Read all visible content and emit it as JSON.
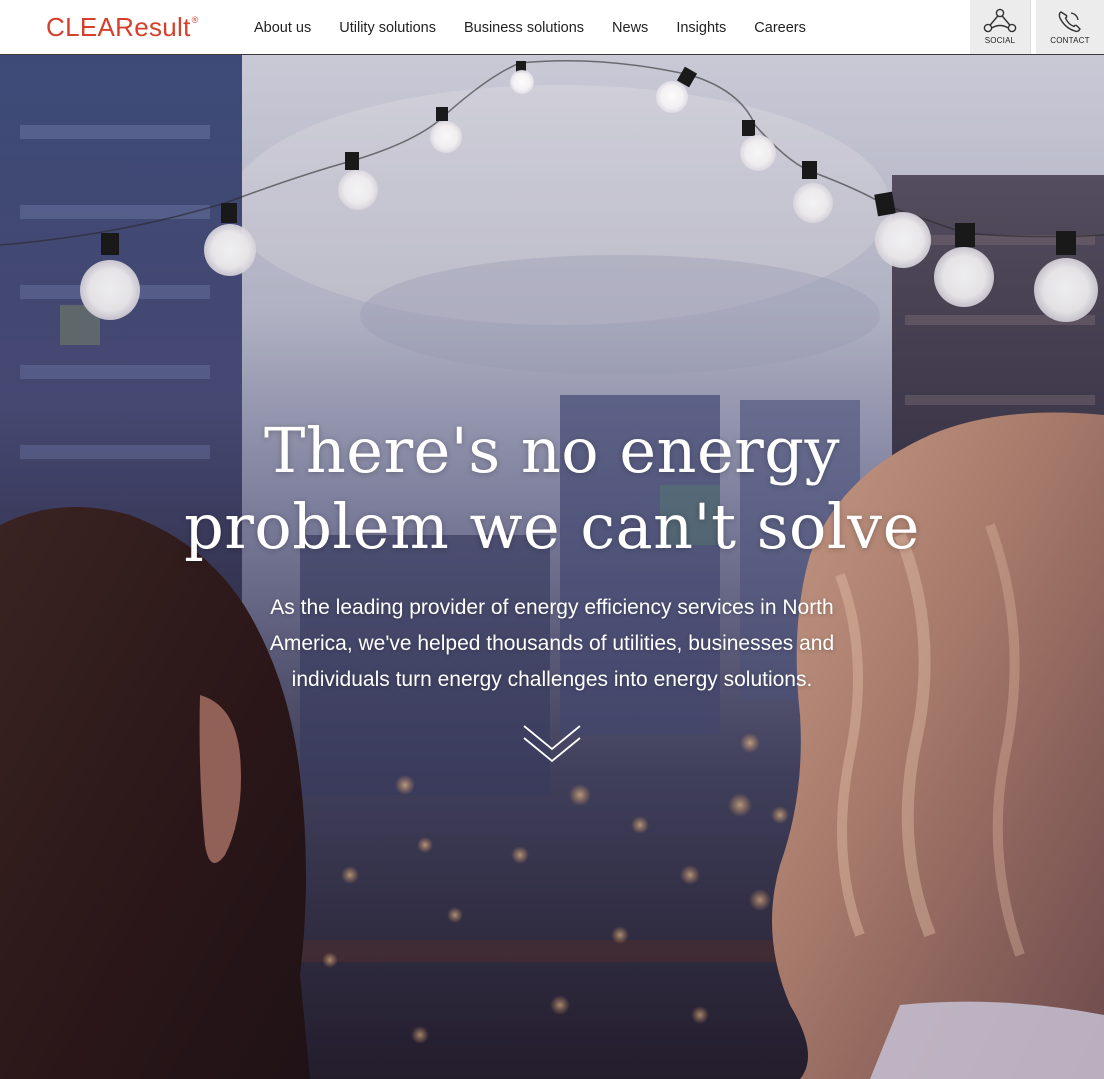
{
  "brand": {
    "name": "CLEAResult",
    "reg_mark": "®",
    "color": "#d4402c"
  },
  "nav": {
    "items": [
      {
        "label": "About us"
      },
      {
        "label": "Utility solutions"
      },
      {
        "label": "Business solutions"
      },
      {
        "label": "News"
      },
      {
        "label": "Insights"
      },
      {
        "label": "Careers"
      }
    ]
  },
  "utility": {
    "social": {
      "label": "SOCIAL",
      "icon": "share-network-icon"
    },
    "contact": {
      "label": "CONTACT",
      "icon": "phone-icon"
    }
  },
  "hero": {
    "headline_line1": "There's no energy",
    "headline_line2": "problem we can't solve",
    "subtext": "As the leading provider of energy efficiency services in North America, we've helped thousands of utilities, businesses and individuals turn energy challenges into energy solutions.",
    "scroll_icon": "chevron-down-icon"
  }
}
